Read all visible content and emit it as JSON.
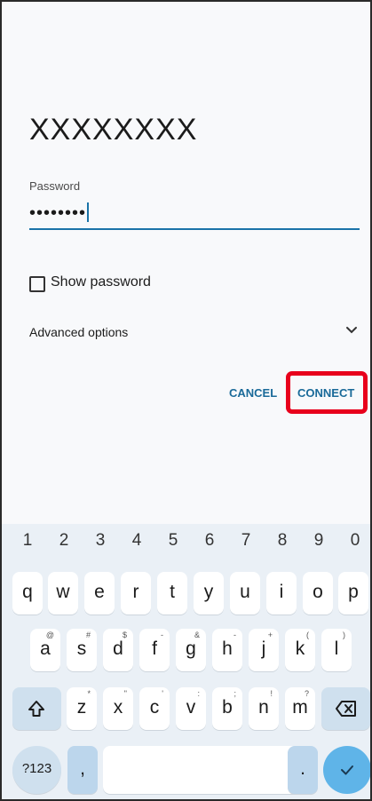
{
  "dialog": {
    "network_name": "XXXXXXXX",
    "password_label": "Password",
    "password_value": "••••••••",
    "show_password_label": "Show password",
    "advanced_options_label": "Advanced options",
    "cancel_label": "CANCEL",
    "connect_label": "CONNECT"
  },
  "keyboard": {
    "numbers": [
      "1",
      "2",
      "3",
      "4",
      "5",
      "6",
      "7",
      "8",
      "9",
      "0"
    ],
    "row1": [
      "q",
      "w",
      "e",
      "r",
      "t",
      "y",
      "u",
      "i",
      "o",
      "p"
    ],
    "row2": [
      {
        "key": "a",
        "alt": "@"
      },
      {
        "key": "s",
        "alt": "#"
      },
      {
        "key": "d",
        "alt": "$"
      },
      {
        "key": "f",
        "alt": "-"
      },
      {
        "key": "g",
        "alt": "&"
      },
      {
        "key": "h",
        "alt": "-"
      },
      {
        "key": "j",
        "alt": "+"
      },
      {
        "key": "k",
        "alt": "("
      },
      {
        "key": "l",
        "alt": ")"
      }
    ],
    "row3": [
      {
        "key": "z",
        "alt": "*"
      },
      {
        "key": "x",
        "alt": "\""
      },
      {
        "key": "c",
        "alt": "'"
      },
      {
        "key": "v",
        "alt": ":"
      },
      {
        "key": "b",
        "alt": ";"
      },
      {
        "key": "n",
        "alt": "!"
      },
      {
        "key": "m",
        "alt": "?"
      }
    ],
    "symbols_label": "?123",
    "comma_label": ",",
    "period_label": ".",
    "shift_icon": "shift-icon",
    "backspace_icon": "backspace-icon",
    "enter_icon": "check-icon"
  },
  "colors": {
    "accent": "#1a73a8",
    "highlight": "#e8001c",
    "keyboard_bg": "#eaf0f6",
    "enter_key": "#5fb4e8"
  }
}
